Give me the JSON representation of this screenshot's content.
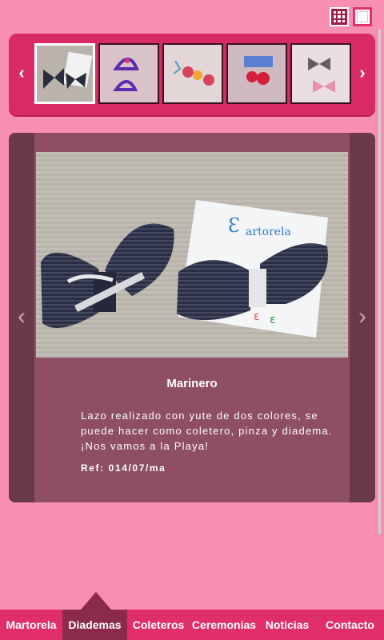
{
  "view_toggles": {
    "grid_icon": "grid-icon",
    "single_icon": "single-view-icon"
  },
  "thumbnails": {
    "prev_glyph": "‹",
    "next_glyph": "›",
    "items": [
      {
        "subject": "navy-bows-photo",
        "active": true
      },
      {
        "subject": "purple-hats-photo",
        "active": false
      },
      {
        "subject": "red-clips-photo",
        "active": false
      },
      {
        "subject": "red-hairclip-photo",
        "active": false
      },
      {
        "subject": "pink-bows-photo",
        "active": false
      }
    ]
  },
  "viewer": {
    "prev_glyph": "‹",
    "next_glyph": "›",
    "title": "Marinero",
    "description": "Lazo realizado con yute de dos colores, se puede hacer como coletero, pinza y diadema. ¡Nos vamos a la Playa!",
    "reference": "Ref: 014/07/ma",
    "card_brand": "artorela"
  },
  "nav": {
    "items": [
      {
        "label": "Martorela",
        "active": false
      },
      {
        "label": "Diademas",
        "active": true
      },
      {
        "label": "Coleteros",
        "active": false
      },
      {
        "label": "Ceremonias",
        "active": false
      },
      {
        "label": "Noticias",
        "active": false
      },
      {
        "label": "Contacto",
        "active": false
      }
    ]
  },
  "colors": {
    "background": "#f88fb1",
    "accent": "#d82b65",
    "active_nav": "#8c2a4e",
    "viewer_bg": "#8e4e63"
  }
}
